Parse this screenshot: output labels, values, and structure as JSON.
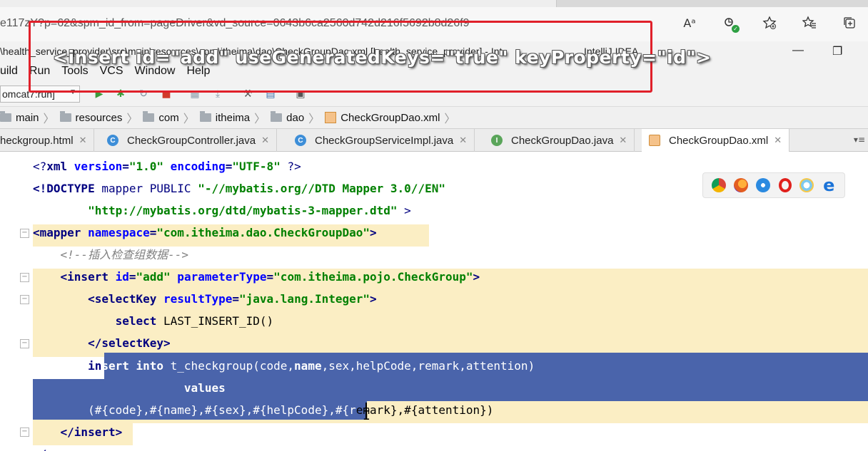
{
  "browser": {
    "url": "e117zY?p=62&spm_id_from=pageDriver&vd_source=0643b6ca2560d742d216f5692b8d26f9",
    "icons": [
      "read-aloud-icon",
      "extension-icon",
      "add-favorite-icon",
      "favorites-icon",
      "collections-icon"
    ],
    "read_aloud_glyph": "Aᵃ"
  },
  "ide": {
    "title": "\\health_service_provider\\src\\main\\resources\\com\\itheima\\dao\\CheckGroupDao.xml [health_service_provider] - IntelliJ IDEA",
    "title_left": "\\health_service_provider\\src\\main\\resources\\com\\itheima\\dao\\CheckGroupDao.xml [health_service_provider] - Int",
    "title_right": "IntelliJ IDEA",
    "minimize": "—",
    "restore": "❐",
    "menu": [
      "uild",
      "Run",
      "Tools",
      "VCS",
      "Window",
      "Help"
    ],
    "run_config": "omcat7:run]"
  },
  "overlay": {
    "text": "<insert id=\"add\" useGeneratedKeys=\"true\" keyProperty=\"id\">",
    "border_color": "#e0202a"
  },
  "breadcrumb": [
    "main",
    "resources",
    "com",
    "itheima",
    "dao",
    "CheckGroupDao.xml"
  ],
  "tabs": [
    {
      "label": "heckgroup.html",
      "icon": "html-file-icon"
    },
    {
      "label": "CheckGroupController.java",
      "icon": "class-icon",
      "glyph": "C"
    },
    {
      "label": "CheckGroupServiceImpl.java",
      "icon": "class-icon",
      "glyph": "C"
    },
    {
      "label": "CheckGroupDao.java",
      "icon": "interface-icon",
      "glyph": "I"
    },
    {
      "label": "CheckGroupDao.xml",
      "icon": "xml-file-icon",
      "active": true
    }
  ],
  "code": {
    "l1": {
      "a": "<?",
      "b": "xml ",
      "c": "version",
      "d": "=",
      "e": "\"1.0\"",
      "f": " encoding",
      "g": "=",
      "h": "\"UTF-8\"",
      "i": " ?>"
    },
    "l2": {
      "a": "<!DOCTYPE ",
      "b": "mapper PUBLIC ",
      "c": "\"-//mybatis.org//DTD Mapper 3.0//EN\""
    },
    "l3": {
      "a": "        ",
      "b": "\"http://mybatis.org/dtd/mybatis-3-mapper.dtd\"",
      "c": " >"
    },
    "l4": {
      "a": "<mapper ",
      "b": "namespace",
      "c": "=",
      "d": "\"com.itheima.dao.CheckGroupDao\"",
      "e": ">"
    },
    "l5": "    <!--插入检查组数据-->",
    "l6": {
      "a": "    <insert ",
      "b": "id",
      "c": "=",
      "d": "\"add\"",
      "e": " parameterType",
      "f": "=",
      "g": "\"com.itheima.pojo.CheckGroup\"",
      "h": ">"
    },
    "l7": {
      "a": "        <selectKey ",
      "b": "resultType",
      "c": "=",
      "d": "\"java.lang.Integer\"",
      "e": ">"
    },
    "l8": {
      "a": "            select ",
      "b": "LAST_INSERT_ID()"
    },
    "l9": "        </selectKey>",
    "l10": {
      "a": "        in",
      "b": "sert into ",
      "c": "t_checkgroup(code,",
      "d": "name",
      "e": ",sex,helpCode,remark,attention)"
    },
    "l11": {
      "a": "                      ",
      "b": "values"
    },
    "l12": {
      "a": "        (#{code},#{name},#{sex},#{helpCode},#{r",
      "b": "emark},#{attention})"
    },
    "l13": "    </insert>",
    "l14": "</mapper>"
  },
  "colors": {
    "selection": "#4a64ab",
    "highlight": "#fbeec4",
    "tag": "#000080",
    "attr": "#0000ff",
    "string": "#008000"
  },
  "preview_browsers": [
    "chrome-icon",
    "firefox-icon",
    "safari-icon",
    "opera-icon",
    "ie-icon",
    "edge-icon"
  ]
}
